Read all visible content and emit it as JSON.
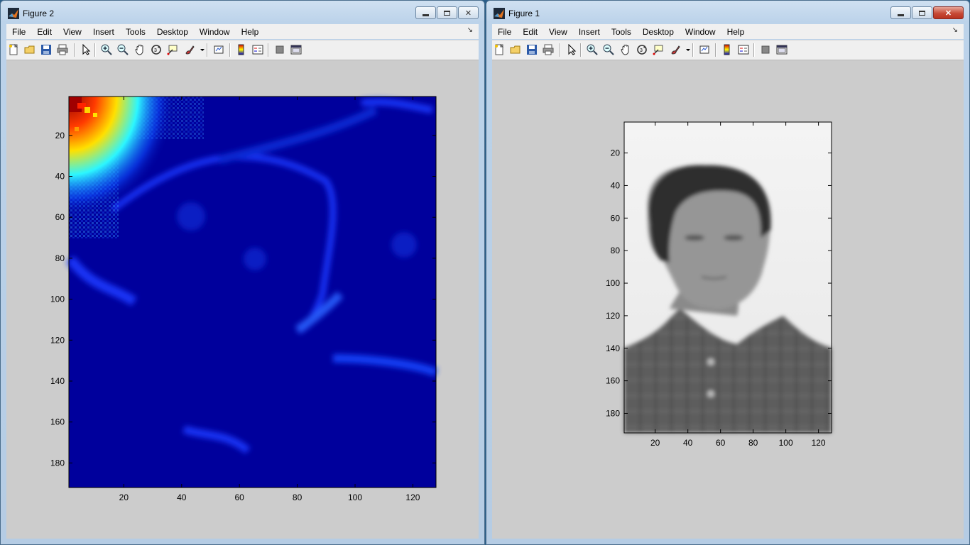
{
  "windows": [
    {
      "title": "Figure 2",
      "menu": [
        "File",
        "Edit",
        "View",
        "Insert",
        "Tools",
        "Desktop",
        "Window",
        "Help"
      ],
      "menu_overflow": "↘",
      "axes": {
        "image_kind": "jet colormap of image coefficients (mostly dark blue, red/yellow at top-left)",
        "xticks": [
          "20",
          "40",
          "60",
          "80",
          "100",
          "120"
        ],
        "yticks": [
          "20",
          "40",
          "60",
          "80",
          "100",
          "120",
          "140",
          "160",
          "180"
        ]
      }
    },
    {
      "title": "Figure 1",
      "menu": [
        "File",
        "Edit",
        "View",
        "Insert",
        "Tools",
        "Desktop",
        "Window",
        "Help"
      ],
      "menu_overflow": "↘",
      "axes": {
        "image_kind": "grayscale portrait photograph",
        "xticks": [
          "20",
          "40",
          "60",
          "80",
          "100",
          "120"
        ],
        "yticks": [
          "20",
          "40",
          "60",
          "80",
          "100",
          "120",
          "140",
          "160",
          "180"
        ]
      }
    }
  ],
  "toolbar_icons": [
    "new-figure-icon",
    "open-file-icon",
    "save-icon",
    "print-icon",
    "select-arrow-icon",
    "zoom-in-icon",
    "zoom-out-icon",
    "pan-hand-icon",
    "rotate-3d-icon",
    "data-cursor-icon",
    "brush-icon",
    "link-plot-icon",
    "colorbar-icon",
    "legend-icon",
    "hide-plot-tools-icon",
    "show-plot-tools-icon"
  ],
  "chart_data": [
    {
      "type": "heatmap",
      "title": "",
      "xlabel": "",
      "ylabel": "",
      "xlim": [
        1,
        128
      ],
      "ylim": [
        1,
        192
      ],
      "y_direction": "reversed",
      "colormap": "jet",
      "grid": false
    },
    {
      "type": "heatmap",
      "title": "",
      "xlabel": "",
      "ylabel": "",
      "xlim": [
        1,
        128
      ],
      "ylim": [
        1,
        192
      ],
      "y_direction": "reversed",
      "colormap": "gray",
      "grid": false
    }
  ]
}
